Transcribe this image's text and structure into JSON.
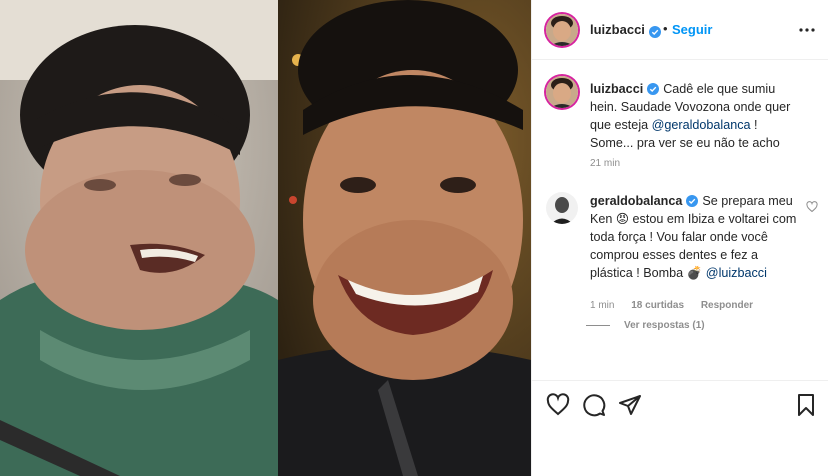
{
  "post": {
    "author": "luizbacci",
    "follow_label": "Seguir",
    "separator": "•"
  },
  "caption": {
    "username": "luizbacci",
    "text_before": "Cadê ele que sumiu hein. Saudade Vovozona onde quer que esteja ",
    "mention": "@geraldobalanca",
    "text_after": " ! Some... pra ver se eu não te acho",
    "time": "21 min"
  },
  "comments": [
    {
      "username": "geraldobalanca",
      "text_before": "Se prepara meu Ken 😡 estou em Ibiza e voltarei com toda força ! Vou falar onde você comprou esses dentes e fez a plástica ! Bomba 💣 ",
      "mention": "@luizbacci",
      "time": "1 min",
      "likes": "18 curtidas",
      "reply_label": "Responder",
      "view_replies": "Ver respostas (1)"
    }
  ],
  "colors": {
    "accent_blue": "#0095f6",
    "mention_blue": "#00376b",
    "meta_gray": "#8e8e8e",
    "text": "#262626",
    "story_ring": "#d6249f"
  },
  "icons": {
    "verified": "verified-badge-icon",
    "more": "more-options-icon",
    "like": "heart-icon",
    "comment": "comment-icon",
    "share": "share-icon",
    "save": "bookmark-icon"
  }
}
